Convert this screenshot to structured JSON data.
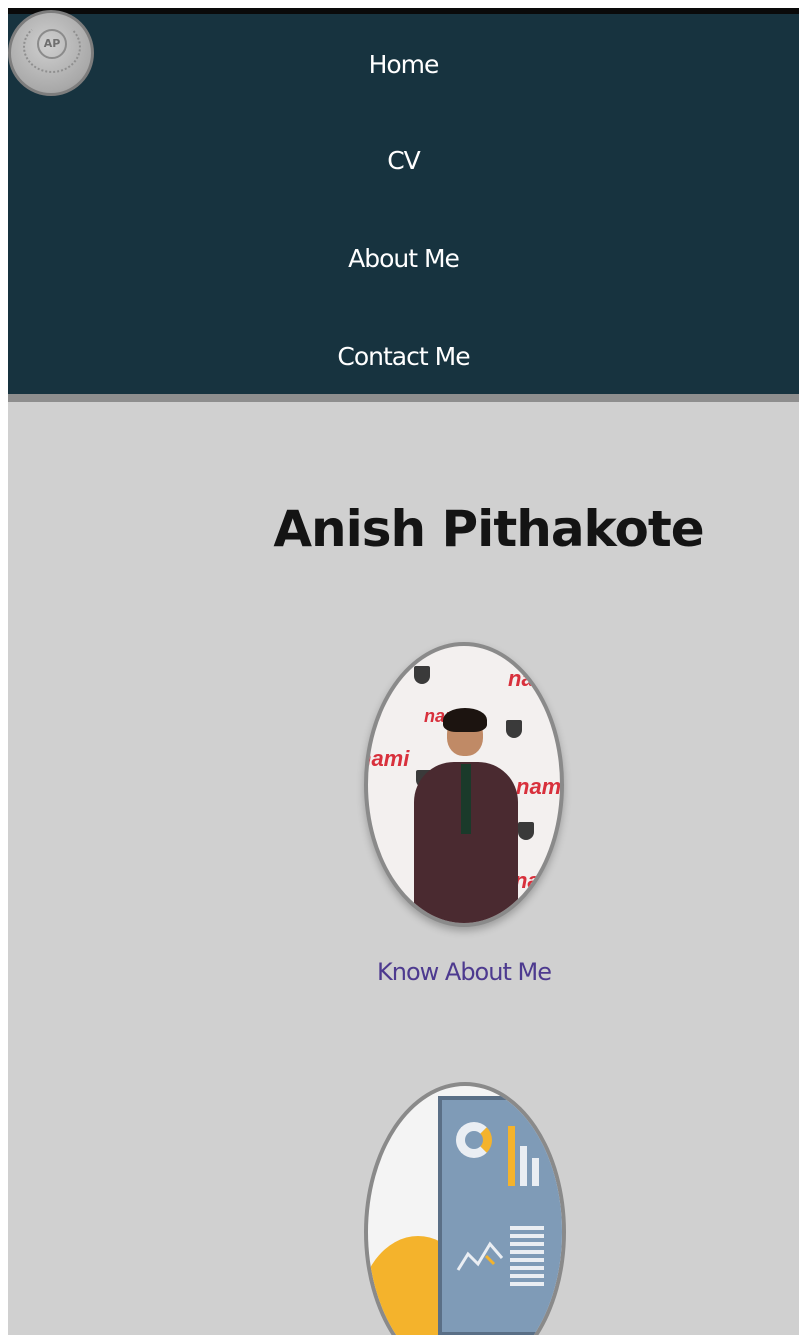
{
  "nav": {
    "items": [
      {
        "label": "Home"
      },
      {
        "label": "CV"
      },
      {
        "label": "About Me"
      },
      {
        "label": "Contact Me"
      }
    ],
    "logo_text": "AP",
    "logo_caption": ""
  },
  "main": {
    "title": "Anish Pithakote",
    "know_link": "Know About Me",
    "photo_banner_text": "nami"
  },
  "colors": {
    "nav_background": "#17333f",
    "page_background": "#d0d0d0",
    "link": "#4d3a8f",
    "nav_text": "#ffffff",
    "accent_yellow": "#f4b32c",
    "monitor_blue": "#7f9bb7"
  }
}
